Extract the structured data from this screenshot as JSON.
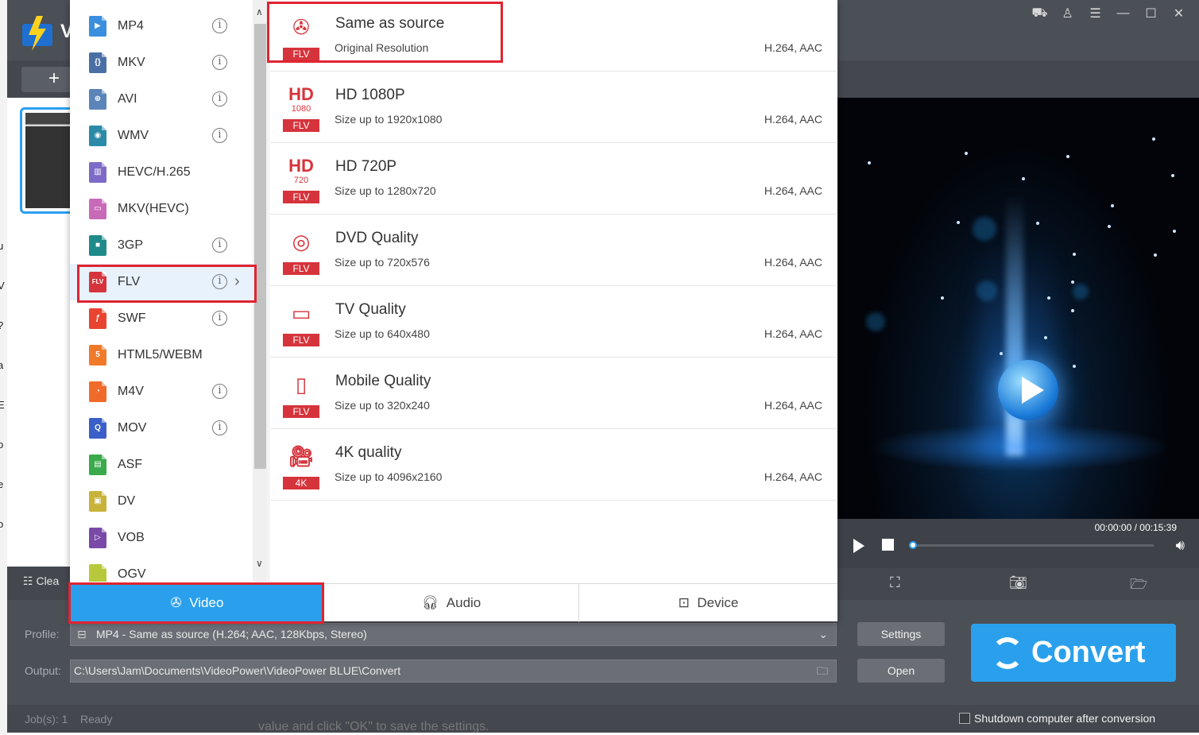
{
  "app": {
    "logo_letter": "V",
    "clean_label": "Clea",
    "thumbnail": "video-thumbnail"
  },
  "left_edge_text": [
    "u",
    "V",
    "?",
    "a",
    "E",
    "o",
    "e",
    "o"
  ],
  "popup": {
    "formats": [
      {
        "label": "MP4",
        "color": "#3a8fde",
        "glyph": "▶",
        "info": true
      },
      {
        "label": "MKV",
        "color": "#4a6fa5",
        "glyph": "{}",
        "info": true
      },
      {
        "label": "AVI",
        "color": "#5b84b8",
        "glyph": "⊕",
        "info": true
      },
      {
        "label": "WMV",
        "color": "#2a8aa8",
        "glyph": "◉",
        "info": true
      },
      {
        "label": "HEVC/H.265",
        "color": "#7d6bc7",
        "glyph": "▥",
        "info": false
      },
      {
        "label": "MKV(HEVC)",
        "color": "#c86ab8",
        "glyph": "▭",
        "info": false
      },
      {
        "label": "3GP",
        "color": "#1f8a8a",
        "glyph": "■",
        "info": true
      },
      {
        "label": "FLV",
        "color": "#d6343c",
        "glyph": "FLV",
        "info": true,
        "selected": true
      },
      {
        "label": "SWF",
        "color": "#e8442f",
        "glyph": "ƒ",
        "info": true
      },
      {
        "label": "HTML5/WEBM",
        "color": "#f07a2a",
        "glyph": "5",
        "info": false
      },
      {
        "label": "M4V",
        "color": "#f06a2a",
        "glyph": "◔",
        "info": true
      },
      {
        "label": "MOV",
        "color": "#3a5fc8",
        "glyph": "Q",
        "info": true
      },
      {
        "label": "ASF",
        "color": "#3aaa4a",
        "glyph": "▤",
        "info": false
      },
      {
        "label": "DV",
        "color": "#c8b23a",
        "glyph": "▣",
        "info": false
      },
      {
        "label": "VOB",
        "color": "#7a4aa8",
        "glyph": "▷",
        "info": false
      },
      {
        "label": "OGV",
        "color": "#b8c83a",
        "glyph": "",
        "info": false
      }
    ],
    "qualities": [
      {
        "title": "Same as source",
        "sub": "Original Resolution",
        "codec": "H.264, AAC",
        "badge": "FLV",
        "glyph": "film-reel-icon"
      },
      {
        "title": "HD 1080P",
        "sub": "Size up to 1920x1080",
        "codec": "H.264, AAC",
        "badge": "FLV",
        "glyph": "hd-1080-icon",
        "hd": "1080"
      },
      {
        "title": "HD 720P",
        "sub": "Size up to 1280x720",
        "codec": "H.264, AAC",
        "badge": "FLV",
        "glyph": "hd-720-icon",
        "hd": "720"
      },
      {
        "title": "DVD Quality",
        "sub": "Size up to 720x576",
        "codec": "H.264, AAC",
        "badge": "FLV",
        "glyph": "disc-icon"
      },
      {
        "title": "TV Quality",
        "sub": "Size up to 640x480",
        "codec": "H.264, AAC",
        "badge": "FLV",
        "glyph": "tv-icon"
      },
      {
        "title": "Mobile Quality",
        "sub": "Size up to 320x240",
        "codec": "H.264, AAC",
        "badge": "FLV",
        "glyph": "mobile-icon"
      },
      {
        "title": "4K quality",
        "sub": "Size up to 4096x2160",
        "codec": "H.264, AAC",
        "badge": "4K",
        "glyph": "camera-icon"
      }
    ],
    "tabs": {
      "video": "Video",
      "audio": "Audio",
      "device": "Device"
    }
  },
  "player": {
    "timecode": "00:00:00 / 00:15:39",
    "progress": 0
  },
  "bottom": {
    "profile_label": "Profile:",
    "profile_value": "MP4 - Same as source (H.264; AAC, 128Kbps, Stereo)",
    "output_label": "Output:",
    "output_value": "C:\\Users\\Jam\\Documents\\VideoPower\\VideoPower BLUE\\Convert",
    "settings_label": "Settings",
    "open_label": "Open",
    "convert_label": "Convert"
  },
  "status": {
    "jobs": "Job(s): 1",
    "state": "Ready",
    "shutdown_label": "Shutdown computer after conversion",
    "bg_text": "value and click \"OK\" to save the settings."
  },
  "colors": {
    "accent": "#2aa0ec",
    "highlight": "#e02430",
    "flv_red": "#d6343c"
  }
}
